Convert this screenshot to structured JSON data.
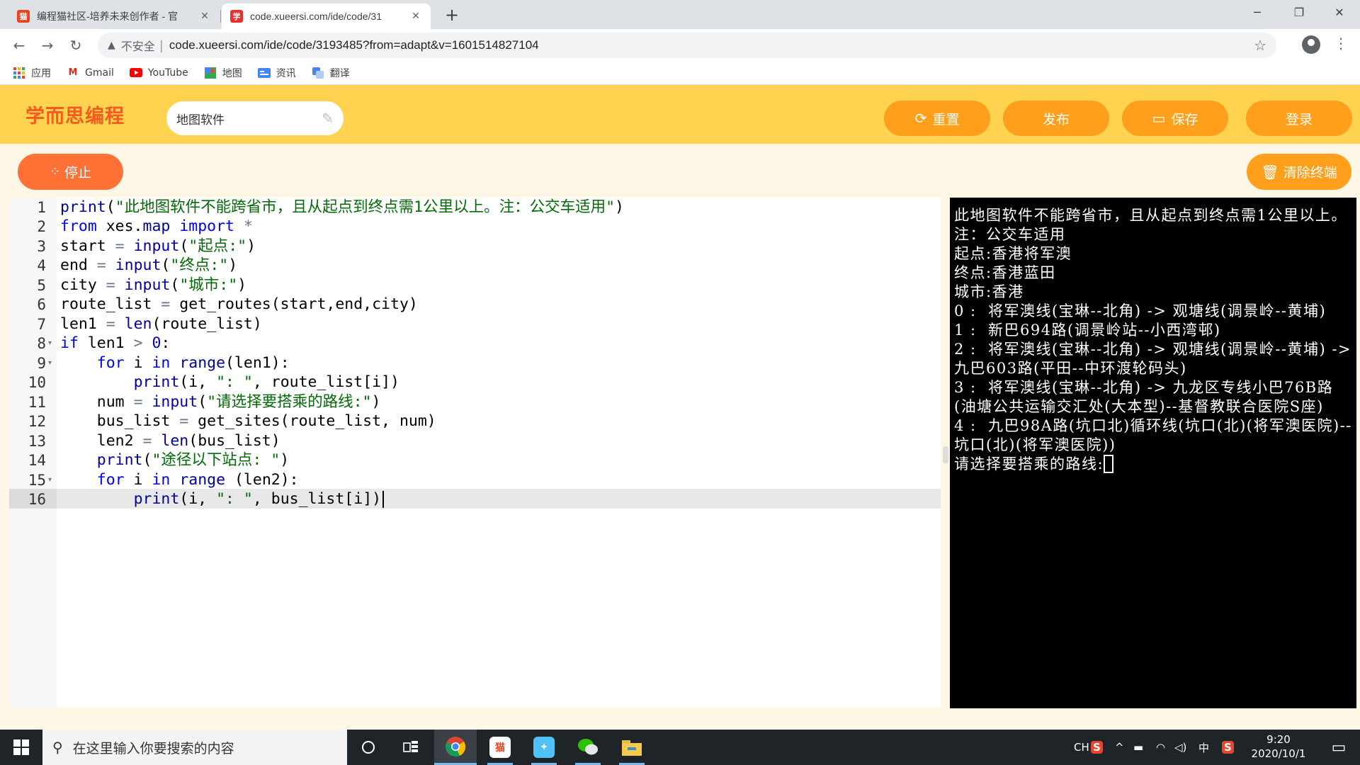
{
  "browser": {
    "tabs": [
      {
        "title": "编程猫社区-培养未来创作者 - 官",
        "favicon": "codemao-icon"
      },
      {
        "title": "code.xueersi.com/ide/code/31",
        "favicon": "xueersi-icon"
      }
    ],
    "new_tab": "+",
    "url_warning": "不安全",
    "url": "code.xueersi.com/ide/code/3193485?from=adapt&v=1601514827104",
    "bookmarks": [
      {
        "label": "应用",
        "icon": "apps-grid-icon"
      },
      {
        "label": "Gmail",
        "icon": "gmail-icon"
      },
      {
        "label": "YouTube",
        "icon": "youtube-icon"
      },
      {
        "label": "地图",
        "icon": "maps-icon"
      },
      {
        "label": "资讯",
        "icon": "news-icon"
      },
      {
        "label": "翻译",
        "icon": "translate-icon"
      }
    ]
  },
  "header": {
    "logo": "学而思编程",
    "project_name": "地图软件",
    "buttons": {
      "reset": "重置",
      "publish": "发布",
      "save": "保存",
      "login": "登录"
    }
  },
  "subbar": {
    "stop": "停止",
    "clear_terminal": "清除终端"
  },
  "editor": {
    "line_numbers": [
      "1",
      "2",
      "3",
      "4",
      "5",
      "6",
      "7",
      "8",
      "9",
      "10",
      "11",
      "12",
      "13",
      "14",
      "15",
      "16"
    ],
    "active_line": 16
  },
  "terminal": {
    "lines": [
      "此地图软件不能跨省市，且从起点到终点需1公里以上。注：公交车适用",
      "起点:香港将军澳",
      "终点:香港蓝田",
      "城市:香港",
      "0 :  将军澳线(宝琳--北角) -> 观塘线(调景岭--黄埔)",
      "1 :  新巴694路(调景岭站--小西湾邨)",
      "2 :  将军澳线(宝琳--北角) -> 观塘线(调景岭--黄埔) -> 九巴603路(平田--中环渡轮码头)",
      "3 :  将军澳线(宝琳--北角) -> 九龙区专线小巴76B路(油塘公共运输交汇处(大本型)--基督教联合医院S座)",
      "4 :  九巴98A路(坑口北)循环线(坑口(北)(将军澳医院)--坑口(北)(将军澳医院))"
    ],
    "prompt": "请选择要搭乘的路线:"
  },
  "taskbar": {
    "search_placeholder": "在这里输入你要搜索的内容",
    "tray_lang": "CH",
    "tray_ime": "中",
    "time": "9:20",
    "date": "2020/10/1"
  },
  "colors": {
    "header_bg": "#ffd34f",
    "button_orange": "#ff9f1c",
    "stop_orange": "#ff7135",
    "logo_orange": "#f55b1f",
    "terminal_bg": "#000000"
  }
}
